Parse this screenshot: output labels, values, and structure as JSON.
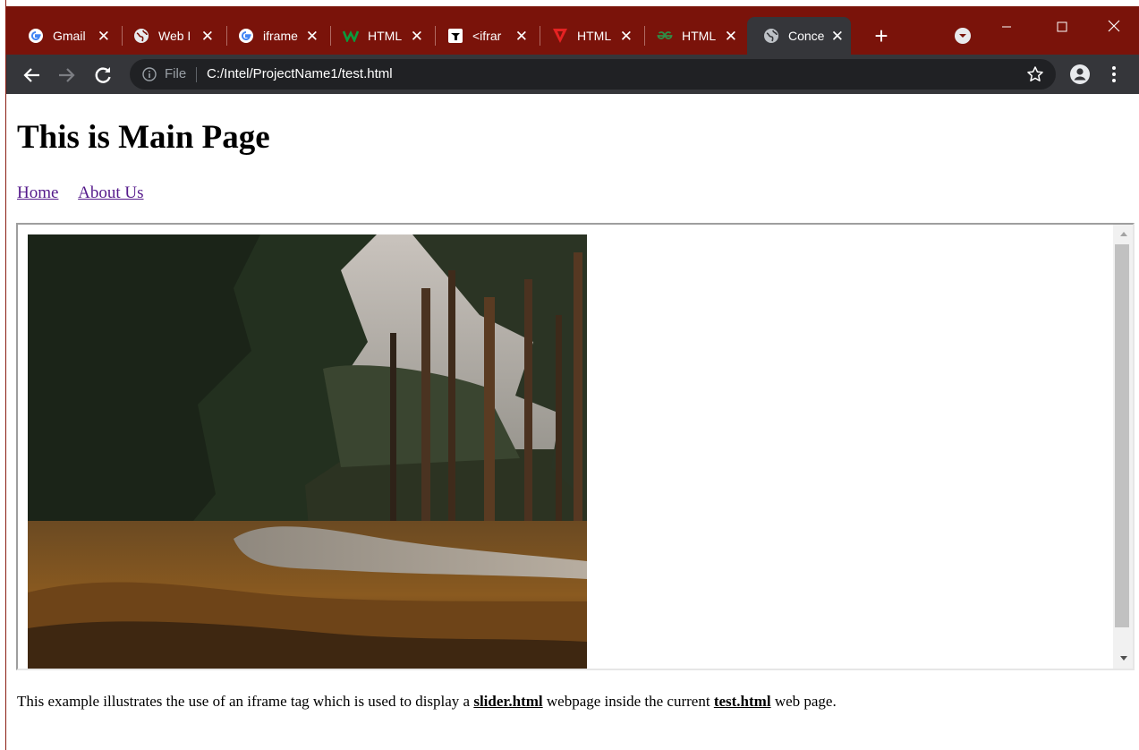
{
  "browser": {
    "tabs": [
      {
        "title": "Gmail",
        "icon": "google-icon"
      },
      {
        "title": "Web I",
        "icon": "globe-icon"
      },
      {
        "title": "iframe",
        "icon": "google-icon"
      },
      {
        "title": "HTML",
        "icon": "w-logo-icon"
      },
      {
        "title": "<ifrar",
        "icon": "dark-logo-icon"
      },
      {
        "title": "HTML",
        "icon": "red-v-icon"
      },
      {
        "title": "HTML",
        "icon": "gfg-logo-icon"
      },
      {
        "title": "Conce",
        "icon": "globe-icon",
        "active": true
      }
    ],
    "close_glyph": "✕",
    "new_tab_glyph": "+",
    "address": {
      "scheme_label": "File",
      "url": "C:/Intel/ProjectName1/test.html"
    },
    "colors": {
      "frame": "#7a130a",
      "toolbar": "#35363a",
      "omnibox": "#202124"
    }
  },
  "page": {
    "title": "This is Main Page",
    "nav": [
      {
        "label": "Home"
      },
      {
        "label": "About Us"
      }
    ],
    "iframe": {
      "image_subject": "forest road photo"
    },
    "caption": {
      "before": "This example illustrates the use of an iframe tag which is used to display a ",
      "link1": "slider.html",
      "middle": " webpage inside the current ",
      "link2": "test.html",
      "after": " web page."
    }
  }
}
